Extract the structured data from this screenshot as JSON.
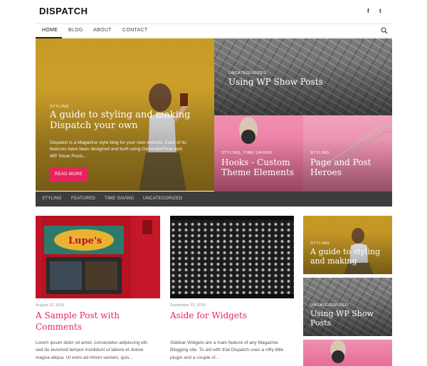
{
  "header": {
    "site_title": "DISPATCH",
    "social": [
      "f",
      "t"
    ]
  },
  "nav": {
    "items": [
      "HOME",
      "BLOG",
      "ABOUT",
      "CONTACT"
    ],
    "active": "HOME"
  },
  "hero": {
    "main": {
      "category": "Styling",
      "title_line1": "A guide to styling and making",
      "title_line2": "Dispatch your own",
      "excerpt_line1": "Dispatch is a Magazine style blog for your new website. Each of its",
      "excerpt_line2": "features have been designed and built using GeneratePress and",
      "excerpt_line3": "WP Show Posts...",
      "button": "READ MORE"
    },
    "top_right": {
      "category": "Uncategorized",
      "title": "Using WP Show Posts"
    },
    "bottom_left": {
      "category": "Styling, Time Saving",
      "title_line1": "Hooks - Custom",
      "title_line2": "Theme Elements"
    },
    "bottom_right": {
      "category": "Styling",
      "title_line1": "Page and Post",
      "title_line2": "Heroes"
    }
  },
  "category_bar": [
    "STYLING",
    "FEATURED",
    "TIME SAVING",
    "UNCATEGORIZED"
  ],
  "posts": [
    {
      "date": "August 22, 2018",
      "title_line1": "A Sample Post with",
      "title_line2": "Comments",
      "excerpt_line1": "Lorem ipsum dolor sit amet, consectetur adipiscing elit,",
      "excerpt_line2": "sed do eiusmod tempor incididunt ut labore et dolore",
      "excerpt_line3": "magna aliqua. Ut enim ad minim veniam, quis..."
    },
    {
      "date": "September 20, 2018",
      "title_line1": "Aside for Widgets",
      "excerpt_line1": "Sidebar Widgets are a main feature of any Magazine",
      "excerpt_line2": "Blogging site. To aid with that Dispatch uses a nifty little",
      "excerpt_line3": "plugin and a couple of..."
    }
  ],
  "sidebar": [
    {
      "category": "Styling",
      "title_line1": "A guide to styling",
      "title_line2": "and making"
    },
    {
      "category": "Uncategorized",
      "title_line1": "Using WP Show",
      "title_line2": "Posts"
    }
  ],
  "colors": {
    "accent": "#e8245e",
    "hero_yellow": "#c69a26",
    "pink": "#e56a96",
    "catbar": "#3d3d3d"
  }
}
